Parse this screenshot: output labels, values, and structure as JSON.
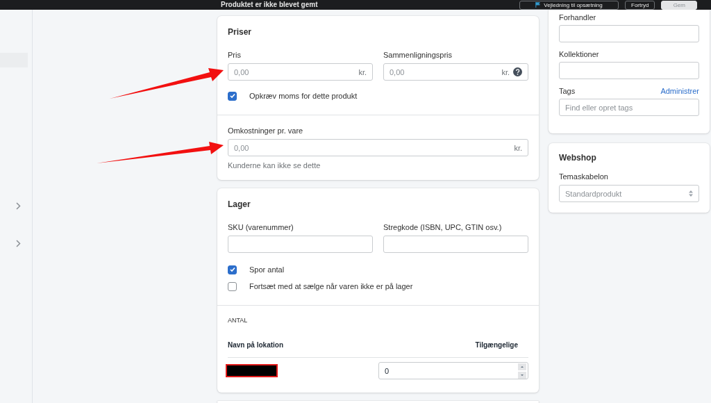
{
  "top_bar": {
    "title": "Produktet er ikke blevet gemt",
    "buttons": [
      {
        "label": "Vejledning til opsætning",
        "kind": "guide"
      },
      {
        "label": "Fortryd",
        "kind": "secondary"
      },
      {
        "label": "Gem",
        "kind": "primary",
        "disabled": true
      }
    ]
  },
  "sidebar": {
    "items": [
      {
        "kind": "highlight"
      },
      {
        "kind": "chevron"
      },
      {
        "kind": "chevron"
      }
    ]
  },
  "pricing": {
    "title": "Priser",
    "fields": [
      {
        "label": "Pris",
        "placeholder": "0,00",
        "suffix": "kr.",
        "help": false
      },
      {
        "label": "Sammenligningspris",
        "placeholder": "0,00",
        "suffix": "kr.",
        "help": true
      }
    ],
    "tax_checkbox": {
      "label": "Opkræv moms for dette produkt",
      "checked": true
    },
    "cost": {
      "label": "Omkostninger pr. vare",
      "placeholder": "0,00",
      "suffix": "kr.",
      "note": "Kunderne kan ikke se dette"
    }
  },
  "inventory": {
    "title": "Lager",
    "fields": [
      {
        "label": "SKU (varenummer)"
      },
      {
        "label": "Stregkode (ISBN, UPC, GTIN osv.)"
      }
    ],
    "checkboxes": [
      {
        "label": "Spor antal",
        "checked": true
      },
      {
        "label": "Fortsæt med at sælge når varen ikke er på lager",
        "checked": false
      }
    ],
    "quantity_heading": "ANTAL",
    "columns": [
      "Navn på lokation",
      "Tilgængelige"
    ],
    "rows": [
      {
        "redacted": true,
        "available": "0"
      }
    ]
  },
  "organization": {
    "fields": [
      {
        "label": "Forhandler",
        "kind": "text"
      },
      {
        "label": "Kollektioner",
        "kind": "text"
      },
      {
        "label": "Tags",
        "link": "Administrer",
        "placeholder": "Find eller opret tags",
        "kind": "text"
      }
    ]
  },
  "webshop": {
    "title": "Webshop",
    "template_label": "Temaskabelon",
    "template_value": "Standardprodukt"
  }
}
